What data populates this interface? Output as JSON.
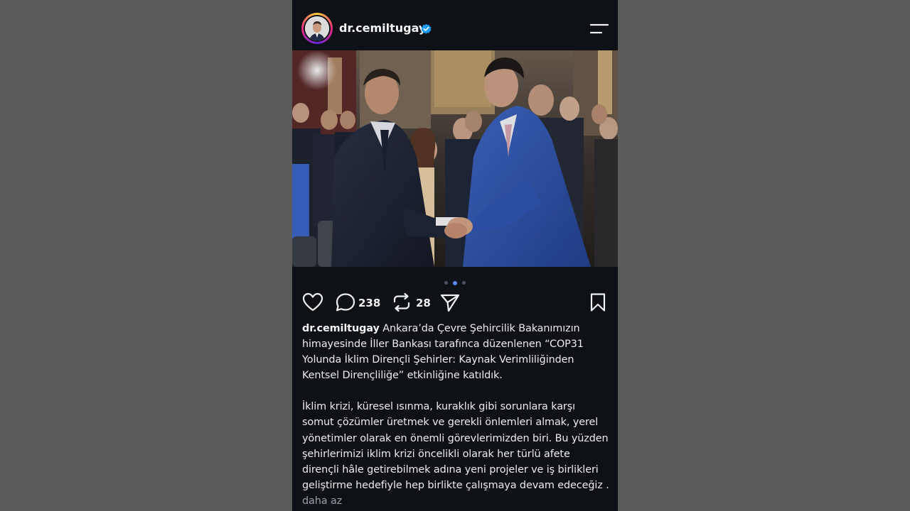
{
  "post": {
    "username": "dr.cemiltugay",
    "verified": true,
    "comments_count": "238",
    "reposts_count": "28",
    "carousel": {
      "count": 3,
      "active_index": 1
    },
    "caption_paragraph_1": "Ankara’da Çevre Şehircilik Bakanımızın himayesinde İller Bankası tarafınca düzenlenen “COP31 Yolunda İklim Dirençli Şehirler: Kaynak Verimliliğinden Kentsel Dirençliliğe” etkinliğine katıldık.",
    "caption_paragraph_2": "İklim krizi, küresel ısınma, kuraklık gibi sorunlara karşı somut çözümler üretmek ve gerekli önlemleri almak, yerel yönetimler olarak en önemli görevlerimizden biri. Bu yüzden şehirlerimizi iklim krizi öncelikli olarak her türlü afete dirençli hâle getirebilmek adına yeni projeler ve iş birlikleri geliştirme hedefiyle hep birlikte çalışmaya devam edeceğiz .",
    "less_label": "daha az"
  },
  "icons": {
    "menu": "menu-icon",
    "like": "heart-icon",
    "comment": "comment-icon",
    "repost": "repost-icon",
    "share": "share-icon",
    "save": "bookmark-icon",
    "verified": "verified-badge-icon"
  },
  "colors": {
    "background": "#5a5a5a",
    "app_background": "#0e1116",
    "verified_blue": "#1d9bf0",
    "active_dot": "#5b8cff",
    "muted_text": "#9aa0a6"
  }
}
